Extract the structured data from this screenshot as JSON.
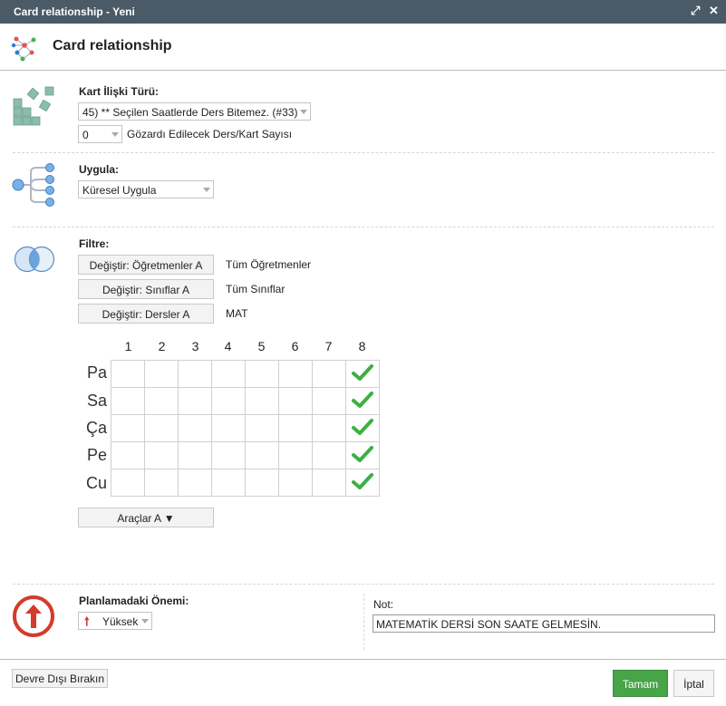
{
  "window": {
    "title": "Card relationship - Yeni",
    "maximize_icon": "expand-icon",
    "close_icon": "close-icon"
  },
  "header": {
    "title": "Card relationship",
    "icon": "network-icon"
  },
  "relation": {
    "label": "Kart İlişki Türü:",
    "type_value": "45) ** Seçilen Saatlerde Ders Bitemez. (#33)",
    "ignore_value": "0",
    "ignore_label": "Gözardı Edilecek Ders/Kart Sayısı",
    "icon": "blocks-icon"
  },
  "apply": {
    "label": "Uygula:",
    "value": "Küresel Uygula",
    "icon": "branch-icon"
  },
  "filter": {
    "label": "Filtre:",
    "icon": "venn-icon",
    "rows": [
      {
        "button": "Değiştir: Öğretmenler A",
        "value": "Tüm Öğretmenler"
      },
      {
        "button": "Değiştir: Sınıflar A",
        "value": "Tüm Sınıflar"
      },
      {
        "button": "Değiştir: Dersler A",
        "value": "MAT"
      }
    ]
  },
  "grid": {
    "columns": [
      "1",
      "2",
      "3",
      "4",
      "5",
      "6",
      "7",
      "8"
    ],
    "rows": [
      "Pa",
      "Sa",
      "Ça",
      "Pe",
      "Cu"
    ],
    "checked_column": 8,
    "check_color": "#3cb043"
  },
  "tools_button": "Araçlar A ▼",
  "priority": {
    "label": "Planlamadaki Önemi:",
    "value": "Yüksek",
    "icon": "arrow-up-circle-icon",
    "color": "#d23c2a"
  },
  "note": {
    "label": "Not:",
    "value": "MATEMATİK DERSİ SON SAATE GELMESİN."
  },
  "footer": {
    "disable": "Devre Dışı Bırakın",
    "ok": "Tamam",
    "cancel": "İptal"
  }
}
